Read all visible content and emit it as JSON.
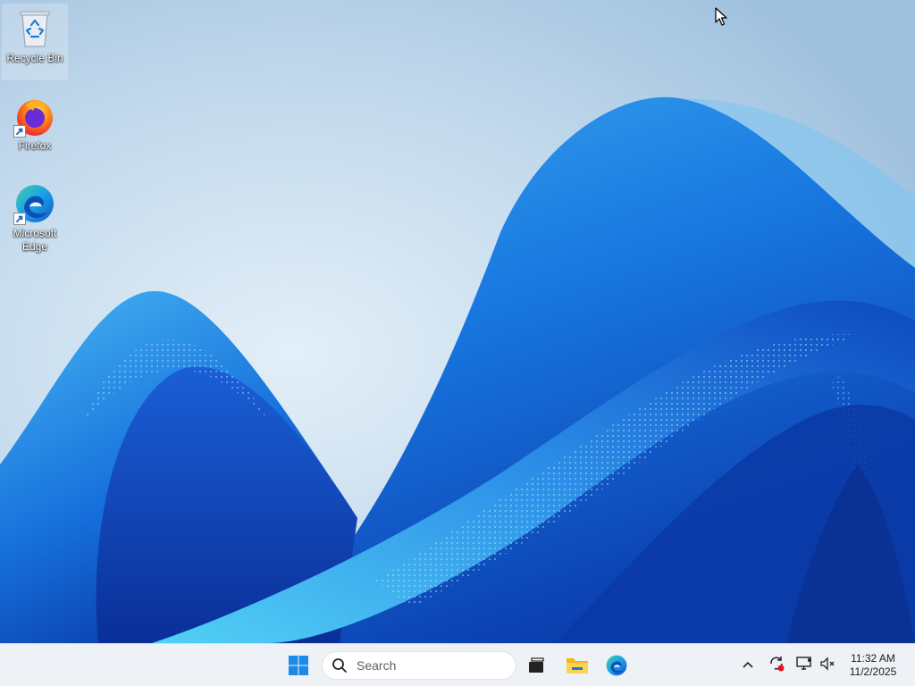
{
  "desktop": {
    "icons": [
      {
        "label": "Recycle Bin",
        "icon": "recycle-bin-icon"
      },
      {
        "label": "Firefox",
        "icon": "firefox-icon"
      },
      {
        "label": "Microsoft Edge",
        "icon": "edge-icon"
      }
    ]
  },
  "taskbar": {
    "search": {
      "placeholder": "Search"
    },
    "pinned": [
      {
        "name": "start",
        "icon": "windows-logo-icon"
      },
      {
        "name": "task-view",
        "icon": "task-view-icon"
      },
      {
        "name": "file-explorer",
        "icon": "folder-icon"
      },
      {
        "name": "edge",
        "icon": "edge-icon"
      }
    ],
    "tray": {
      "chevron": "chevron-up-icon",
      "icons": [
        "sync-icon",
        "display-icon",
        "volume-muted-icon"
      ]
    },
    "clock": {
      "time": "11:32 AM",
      "date": "11/2/2025"
    }
  },
  "colors": {
    "taskbar_bg": "#eef1f6",
    "accent_blue": "#0067c0",
    "wallpaper_sky": "#cfe2f0",
    "wallpaper_deep": "#0a3fb8"
  }
}
